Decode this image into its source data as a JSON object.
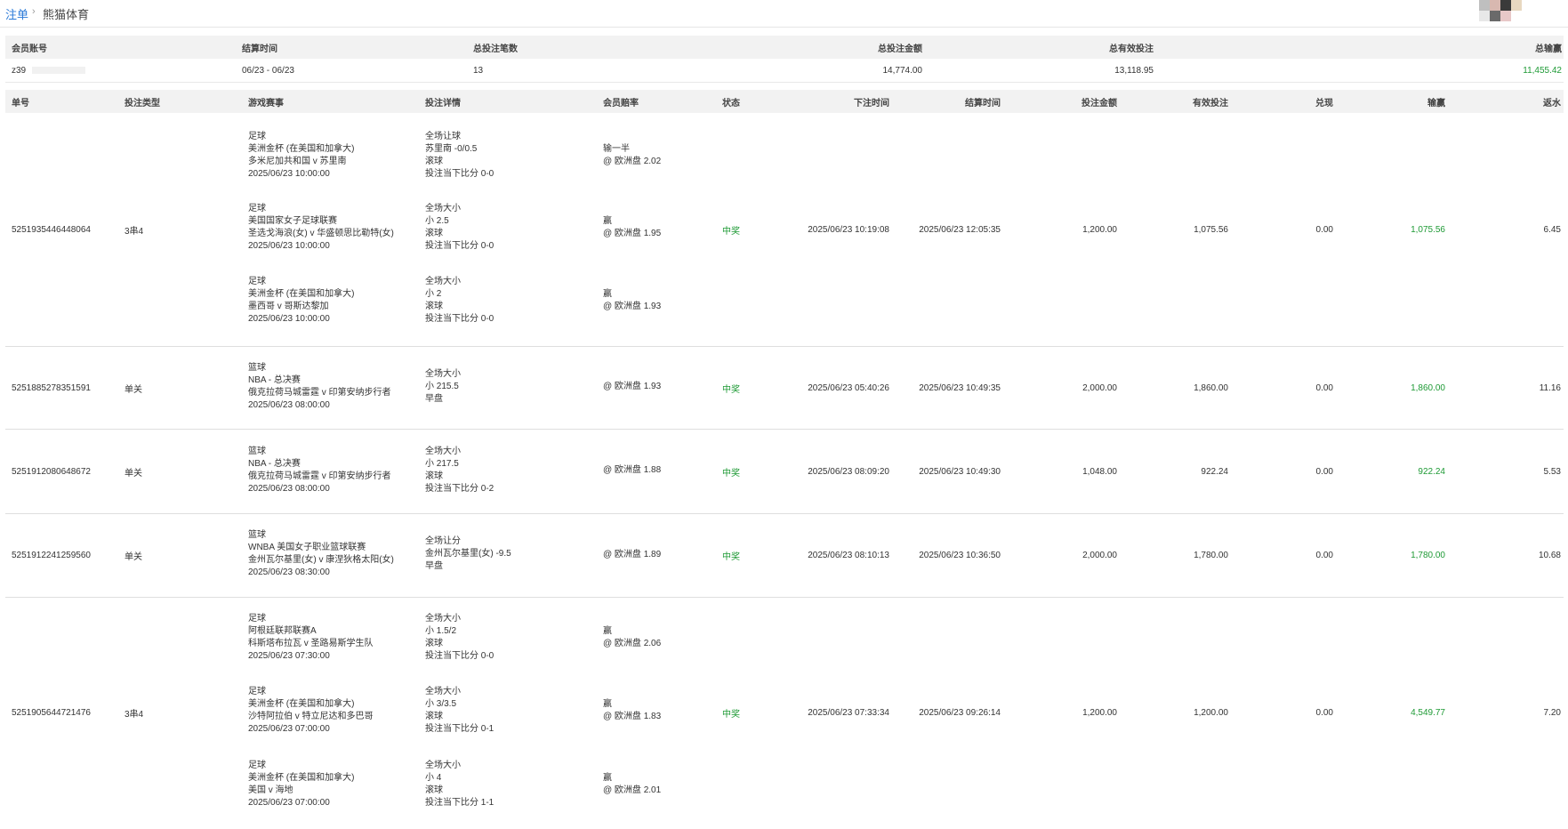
{
  "breadcrumb": {
    "root": "注单",
    "separator": "›",
    "current": "熊猫体育"
  },
  "summary": {
    "headers": [
      "会员账号",
      "结算时间",
      "总投注笔数",
      "总投注金额",
      "总有效投注",
      "总输赢"
    ],
    "values": {
      "account": "z39",
      "period": "06/23 - 06/23",
      "count": "13",
      "amount": "14,774.00",
      "valid": "13,118.95",
      "winloss": "11,455.42"
    }
  },
  "table": {
    "headers": [
      "单号",
      "投注类型",
      "游戏赛事",
      "投注详情",
      "会员赔率",
      "状态",
      "下注时间",
      "结算时间",
      "投注金额",
      "有效投注",
      "兑现",
      "输赢",
      "返水"
    ],
    "rows": [
      {
        "id": "5251935446448064",
        "type": "3串4",
        "status": "中奖",
        "bet_time": "2025/06/23 10:19:08",
        "settle_time": "2025/06/23 12:05:35",
        "amount": "1,200.00",
        "valid": "1,075.56",
        "cashout": "0.00",
        "winloss": "1,075.56",
        "rebate": "6.45",
        "legs": [
          {
            "event": [
              "足球",
              "美洲金杯 (在美国和加拿大)",
              "多米尼加共和国 v 苏里南",
              "2025/06/23 10:00:00"
            ],
            "detail": [
              "全场让球",
              "苏里南 -0/0.5",
              "滚球",
              "投注当下比分 0-0"
            ],
            "odds": [
              "输一半",
              "@ 欧洲盘 2.02"
            ]
          },
          {
            "event": [
              "足球",
              "美国国家女子足球联赛",
              "圣选戈海浪(女) v 华盛顿思比勒特(女)",
              "2025/06/23 10:00:00"
            ],
            "detail": [
              "全场大小",
              "小 2.5",
              "滚球",
              "投注当下比分 0-0"
            ],
            "odds": [
              "赢",
              "@ 欧洲盘 1.95"
            ]
          },
          {
            "event": [
              "足球",
              "美洲金杯 (在美国和加拿大)",
              "墨西哥 v 哥斯达黎加",
              "2025/06/23 10:00:00"
            ],
            "detail": [
              "全场大小",
              "小 2",
              "滚球",
              "投注当下比分 0-0"
            ],
            "odds": [
              "赢",
              "@ 欧洲盘 1.93"
            ]
          }
        ]
      },
      {
        "id": "5251885278351591",
        "type": "单关",
        "status": "中奖",
        "bet_time": "2025/06/23 05:40:26",
        "settle_time": "2025/06/23 10:49:35",
        "amount": "2,000.00",
        "valid": "1,860.00",
        "cashout": "0.00",
        "winloss": "1,860.00",
        "rebate": "11.16",
        "legs": [
          {
            "event": [
              "篮球",
              "NBA - 总决赛",
              "俄克拉荷马城雷霆 v 印第安纳步行者",
              "2025/06/23 08:00:00"
            ],
            "detail": [
              "全场大小",
              "小 215.5",
              "早盘"
            ],
            "odds": [
              "@ 欧洲盘 1.93"
            ]
          }
        ]
      },
      {
        "id": "5251912080648672",
        "type": "单关",
        "status": "中奖",
        "bet_time": "2025/06/23 08:09:20",
        "settle_time": "2025/06/23 10:49:30",
        "amount": "1,048.00",
        "valid": "922.24",
        "cashout": "0.00",
        "winloss": "922.24",
        "rebate": "5.53",
        "legs": [
          {
            "event": [
              "篮球",
              "NBA - 总决赛",
              "俄克拉荷马城雷霆 v 印第安纳步行者",
              "2025/06/23 08:00:00"
            ],
            "detail": [
              "全场大小",
              "小 217.5",
              "滚球",
              "投注当下比分 0-2"
            ],
            "odds": [
              "@ 欧洲盘 1.88"
            ]
          }
        ]
      },
      {
        "id": "5251912241259560",
        "type": "单关",
        "status": "中奖",
        "bet_time": "2025/06/23 08:10:13",
        "settle_time": "2025/06/23 10:36:50",
        "amount": "2,000.00",
        "valid": "1,780.00",
        "cashout": "0.00",
        "winloss": "1,780.00",
        "rebate": "10.68",
        "legs": [
          {
            "event": [
              "篮球",
              "WNBA 美国女子职业篮球联赛",
              "金州瓦尔基里(女) v 康涅狄格太阳(女)",
              "2025/06/23 08:30:00"
            ],
            "detail": [
              "全场让分",
              "金州瓦尔基里(女) -9.5",
              "早盘"
            ],
            "odds": [
              "@ 欧洲盘 1.89"
            ]
          }
        ]
      },
      {
        "id": "5251905644721476",
        "type": "3串4",
        "status": "中奖",
        "bet_time": "2025/06/23 07:33:34",
        "settle_time": "2025/06/23 09:26:14",
        "amount": "1,200.00",
        "valid": "1,200.00",
        "cashout": "0.00",
        "winloss": "4,549.77",
        "rebate": "7.20",
        "legs": [
          {
            "event": [
              "足球",
              "阿根廷联邦联赛A",
              "科斯塔布拉瓦 v 圣路易斯学生队",
              "2025/06/23 07:30:00"
            ],
            "detail": [
              "全场大小",
              "小 1.5/2",
              "滚球",
              "投注当下比分 0-0"
            ],
            "odds": [
              "赢",
              "@ 欧洲盘 2.06"
            ]
          },
          {
            "event": [
              "足球",
              "美洲金杯 (在美国和加拿大)",
              "沙特阿拉伯 v 特立尼达和多巴哥",
              "2025/06/23 07:00:00"
            ],
            "detail": [
              "全场大小",
              "小 3/3.5",
              "滚球",
              "投注当下比分 0-1"
            ],
            "odds": [
              "赢",
              "@ 欧洲盘 1.83"
            ]
          },
          {
            "event": [
              "足球",
              "美洲金杯 (在美国和加拿大)",
              "美国 v 海地",
              "2025/06/23 07:00:00"
            ],
            "detail": [
              "全场大小",
              "小 4",
              "滚球",
              "投注当下比分 1-1"
            ],
            "odds": [
              "赢",
              "@ 欧洲盘 2.01"
            ]
          }
        ]
      }
    ]
  },
  "colors": {
    "link": "#2b7ad8",
    "win": "#1e9a35",
    "header_bg": "#f2f2f2",
    "border": "#dedede"
  },
  "icons": {
    "avatar": "user-avatar-icon"
  }
}
